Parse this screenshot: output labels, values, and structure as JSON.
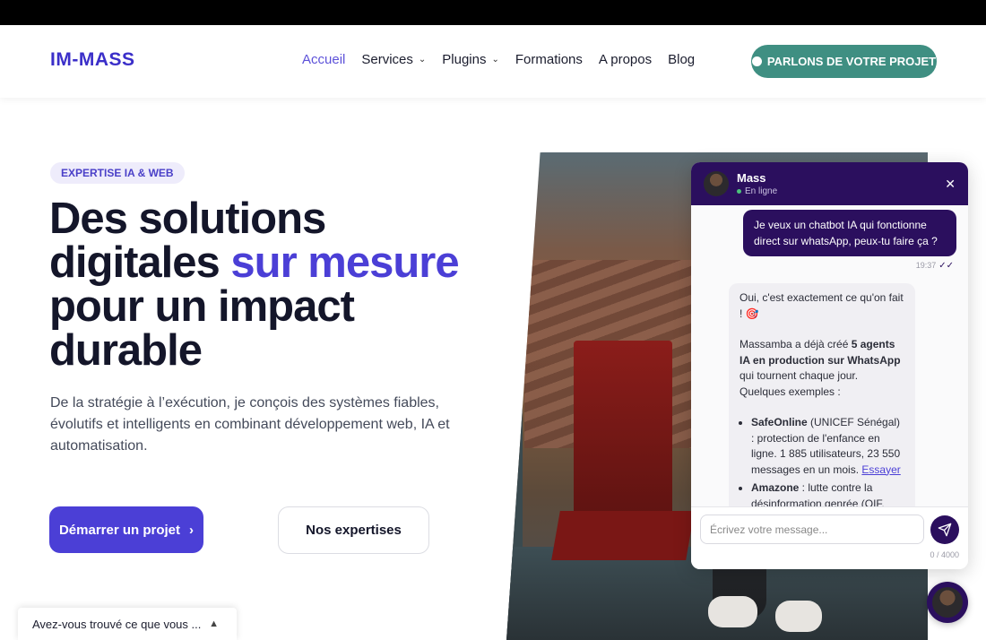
{
  "header": {
    "logo": "IM-MASS",
    "nav": [
      {
        "label": "Accueil",
        "active": true,
        "dropdown": false
      },
      {
        "label": "Services",
        "active": false,
        "dropdown": true
      },
      {
        "label": "Plugins",
        "active": false,
        "dropdown": true
      },
      {
        "label": "Formations",
        "active": false,
        "dropdown": false
      },
      {
        "label": "A propos",
        "active": false,
        "dropdown": false
      },
      {
        "label": "Blog",
        "active": false,
        "dropdown": false
      }
    ],
    "cta": "PARLONS DE VOTRE PROJET",
    "cta_color": "#3f8f82"
  },
  "hero": {
    "badge": "EXPERTISE IA & WEB",
    "title_part1": "Des solutions digitales ",
    "title_accent": "sur mesure",
    "title_part2": " pour un impact durable",
    "description": "De la stratégie à l’exécution, je conçois des systèmes fiables, évolutifs et intelligents en combinant développement web, IA et automatisation.",
    "primary_button": "Démarrer un projet",
    "primary_chevron": "›",
    "secondary_button": "Nos expertises",
    "accent_color": "#4b3fd6"
  },
  "chat": {
    "name": "Mass",
    "status": "En ligne",
    "close": "✕",
    "user_message": "Je veux un chatbot IA qui fonctionne direct sur whatsApp, peux-tu faire ça ?",
    "user_time": "19:37",
    "user_ticks": "✓✓",
    "bot_intro": "Oui, c'est exactement ce qu'on fait ! 🎯",
    "bot_line_pre": "Massamba a déjà créé ",
    "bot_line_bold": "5 agents IA en production sur WhatsApp",
    "bot_line_post": " qui tournent chaque jour. Quelques exemples :",
    "items": [
      {
        "name": "SafeOnline",
        "text": " (UNICEF Sénégal) : protection de l'enfance en ligne. 1 885 utilisateurs, 23 550 messages en un mois. ",
        "link": "Essayer"
      },
      {
        "name": "Amazone",
        "text": " : lutte contre la désinformation genrée (OIF, Autriche). ",
        "link": ""
      }
    ],
    "input_placeholder": "Écrivez votre message...",
    "counter": "0 / 4000",
    "header_color": "#2b0f5e"
  },
  "survey": {
    "text": "Avez-vous trouvé ce que vous ...",
    "arrow": "▲"
  }
}
